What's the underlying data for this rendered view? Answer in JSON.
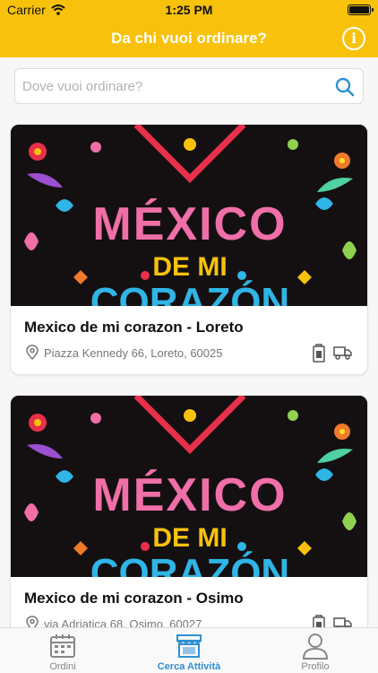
{
  "status": {
    "carrier": "Carrier",
    "time": "1:25 PM"
  },
  "nav": {
    "title": "Da chi vuoi ordinare?",
    "info_icon": "info-icon",
    "info_glyph": "i"
  },
  "search": {
    "placeholder": "Dove vuoi ordinare?",
    "value": "",
    "icon": "search-icon"
  },
  "image_text": {
    "line1": "MÉXICO",
    "line2": "DE MI",
    "line3": "CORAZÓN"
  },
  "restaurants": [
    {
      "name": "Mexico de mi corazon - Loreto",
      "address": "Piazza Kennedy 66, Loreto, 60025"
    },
    {
      "name": "Mexico de mi corazon - Osimo",
      "address": "via Adriatica 68, Osimo, 60027"
    }
  ],
  "tabs": [
    {
      "label": "Ordini",
      "icon": "calendar-icon"
    },
    {
      "label": "Cerca Attività",
      "icon": "store-icon"
    },
    {
      "label": "Profilo",
      "icon": "person-icon"
    }
  ],
  "colors": {
    "accent": "#f8c20c",
    "active_tab": "#2f8fd3",
    "inactive_tab": "#888888"
  }
}
